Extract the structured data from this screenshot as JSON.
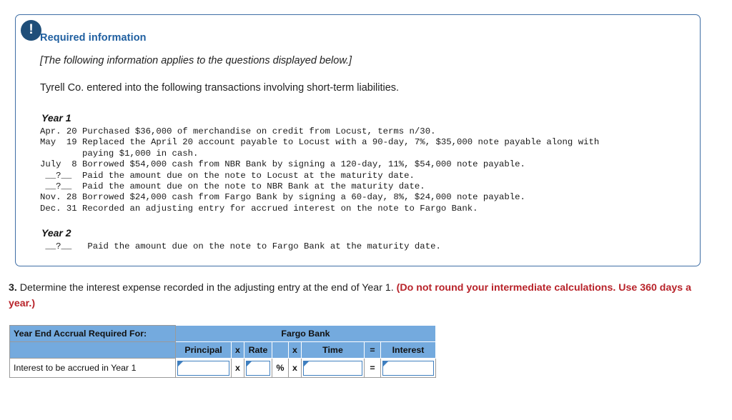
{
  "panel": {
    "alert_icon": "exclamation-icon",
    "title": "Required information",
    "italic_note": "[The following information applies to the questions displayed below.]",
    "intro": "Tyrell Co. entered into the following transactions involving short-term liabilities.",
    "year1_label": "Year 1",
    "year1_transactions": "Apr. 20 Purchased $36,000 of merchandise on credit from Locust, terms n/30.\nMay  19 Replaced the April 20 account payable to Locust with a 90-day, 7%, $35,000 note payable along with\n        paying $1,000 in cash.\nJuly  8 Borrowed $54,000 cash from NBR Bank by signing a 120-day, 11%, $54,000 note payable.\n __?__  Paid the amount due on the note to Locust at the maturity date.\n __?__  Paid the amount due on the note to NBR Bank at the maturity date.\nNov. 28 Borrowed $24,000 cash from Fargo Bank by signing a 60-day, 8%, $24,000 note payable.\nDec. 31 Recorded an adjusting entry for accrued interest on the note to Fargo Bank.",
    "year2_label": "Year 2",
    "year2_transactions": " __?__   Paid the amount due on the note to Fargo Bank at the maturity date."
  },
  "question": {
    "number": "3.",
    "text": " Determine the interest expense recorded in the adjusting entry at the end of Year 1. ",
    "emphasis": "(Do not round your intermediate calculations. Use 360 days a year.)"
  },
  "table": {
    "corner_header": "Year End Accrual Required For:",
    "bank_header": "Fargo Bank",
    "columns": {
      "principal": "Principal",
      "times1": "x",
      "rate": "Rate",
      "percent_blank": "",
      "times2": "x",
      "time": "Time",
      "equals": "=",
      "interest": "Interest"
    },
    "row": {
      "label": "Interest to be accrued in Year 1",
      "principal_value": "",
      "op1": "x",
      "rate_value": "",
      "percent_sign": "%",
      "op2": "x",
      "time_value": "",
      "op3": "=",
      "interest_value": ""
    }
  },
  "colors": {
    "panel_border": "#3f6ea5",
    "badge": "#1f4e79",
    "title_blue": "#1f5fa0",
    "table_header_blue": "#74aade",
    "emphasis_red": "#b8232a",
    "input_border": "#3f7fbf"
  }
}
